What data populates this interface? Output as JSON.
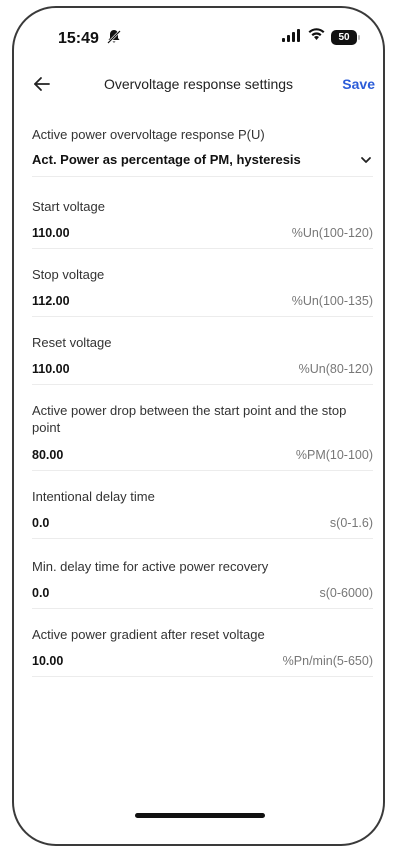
{
  "status_bar": {
    "time": "15:49",
    "battery": "50",
    "icons": [
      "bell-slash-icon",
      "signal-icon",
      "wifi-icon",
      "battery-icon"
    ]
  },
  "header": {
    "back_icon": "arrow-left-icon",
    "title": "Overvoltage response settings",
    "save_label": "Save",
    "accent_color": "#2b5cd8"
  },
  "mode": {
    "label": "Active power overvoltage response P(U)",
    "value": "Act. Power as percentage of PM, hysteresis",
    "icon": "chevron-down-icon"
  },
  "fields": [
    {
      "label": "Start voltage",
      "value": "110.00",
      "range": "%Un(100-120)"
    },
    {
      "label": "Stop voltage",
      "value": "112.00",
      "range": "%Un(100-135)"
    },
    {
      "label": "Reset voltage",
      "value": "110.00",
      "range": "%Un(80-120)"
    },
    {
      "label": "Active power drop between the start point and the stop point",
      "value": "80.00",
      "range": "%PM(10-100)"
    },
    {
      "label": "Intentional delay time",
      "value": "0.0",
      "range": "s(0-1.6)"
    },
    {
      "label": "Min. delay time for active power recovery",
      "value": "0.0",
      "range": "s(0-6000)"
    },
    {
      "label": "Active power gradient after reset voltage",
      "value": "10.00",
      "range": "%Pn/min(5-650)"
    }
  ]
}
